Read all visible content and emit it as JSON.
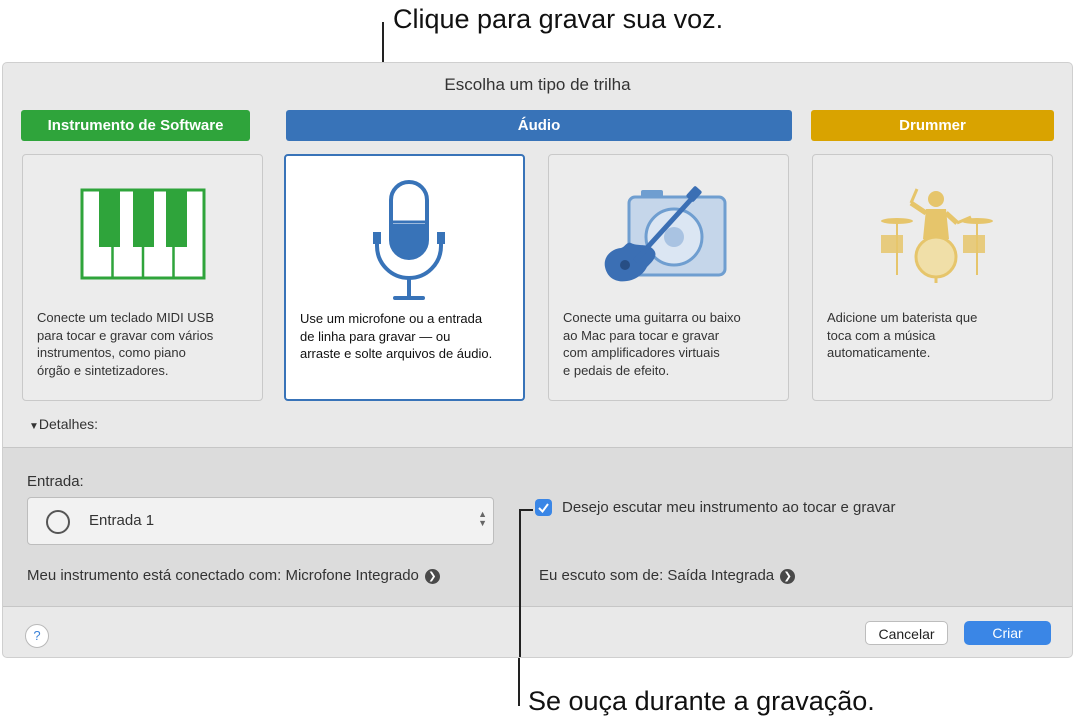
{
  "callouts": {
    "top": "Clique para gravar sua voz.",
    "bottom": "Se ouça durante a gravação."
  },
  "dialog": {
    "title": "Escolha um tipo de trilha",
    "categories": [
      {
        "label": "Instrumento de Software",
        "color": "#2fa43b"
      },
      {
        "label": "Áudio",
        "color": "#3873b8"
      },
      {
        "label": "Drummer",
        "color": "#d9a300"
      }
    ],
    "cards": [
      {
        "icon": "piano-keyboard-icon",
        "description": "Conecte um teclado MIDI USB\npara tocar e gravar com vários\ninstrumentos, como piano\nórgão e sintetizadores."
      },
      {
        "icon": "microphone-icon",
        "selected": true,
        "description": "Use um microfone ou a entrada\nde linha para gravar — ou\narraste e solte arquivos de áudio."
      },
      {
        "icon": "guitar-amplifier-icon",
        "description": "Conecte uma guitarra ou baixo\nao Mac para tocar e gravar\ncom amplificadores virtuais\ne pedais de efeito."
      },
      {
        "icon": "drummer-icon",
        "description": "Adicione um baterista que\ntoca com a música\nautomaticamente."
      }
    ],
    "details_label": "Detalhes:",
    "input_label": "Entrada:",
    "input_value": "Entrada 1",
    "monitor_label": "Desejo escutar meu instrumento ao tocar e gravar",
    "monitor_checked": true,
    "connected_label": "Meu instrumento está conectado com: Microfone Integrado",
    "output_label": "Eu escuto som de: Saída Integrada",
    "help_label": "?",
    "cancel_label": "Cancelar",
    "create_label": "Criar"
  }
}
